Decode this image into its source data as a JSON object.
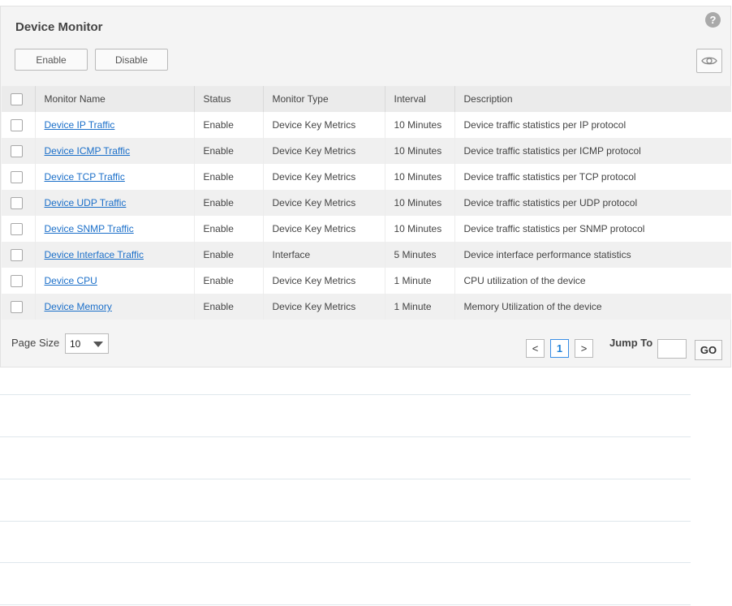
{
  "panel": {
    "title": "Device Monitor",
    "help_glyph": "?",
    "enable_label": "Enable",
    "disable_label": "Disable",
    "eye_icon": "eye-icon"
  },
  "table": {
    "columns": [
      "Monitor Name",
      "Status",
      "Monitor Type",
      "Interval",
      "Description"
    ],
    "rows": [
      {
        "name": "Device IP Traffic",
        "status": "Enable",
        "type": "Device Key Metrics",
        "interval": "10 Minutes",
        "description": "Device traffic statistics per IP protocol"
      },
      {
        "name": "Device ICMP Traffic",
        "status": "Enable",
        "type": "Device Key Metrics",
        "interval": "10 Minutes",
        "description": "Device traffic statistics per ICMP protocol"
      },
      {
        "name": "Device TCP Traffic",
        "status": "Enable",
        "type": "Device Key Metrics",
        "interval": "10 Minutes",
        "description": "Device traffic statistics per TCP protocol"
      },
      {
        "name": "Device UDP Traffic",
        "status": "Enable",
        "type": "Device Key Metrics",
        "interval": "10 Minutes",
        "description": "Device traffic statistics per UDP protocol"
      },
      {
        "name": "Device SNMP Traffic",
        "status": "Enable",
        "type": "Device Key Metrics",
        "interval": "10 Minutes",
        "description": "Device traffic statistics per SNMP protocol"
      },
      {
        "name": "Device Interface Traffic",
        "status": "Enable",
        "type": "Interface",
        "interval": "5 Minutes",
        "description": "Device interface performance statistics"
      },
      {
        "name": "Device CPU",
        "status": "Enable",
        "type": "Device Key Metrics",
        "interval": "1 Minute",
        "description": "CPU utilization of the device"
      },
      {
        "name": "Device Memory",
        "status": "Enable",
        "type": "Device Key Metrics",
        "interval": "1 Minute",
        "description": "Memory Utilization of the device"
      }
    ]
  },
  "pager": {
    "page_size_label": "Page Size",
    "page_size_value": "10",
    "prev_glyph": "<",
    "current_page": "1",
    "next_glyph": ">",
    "jump_label": "Jump To",
    "jump_value": "",
    "go_label": "GO"
  },
  "colors": {
    "link": "#1b6fc9",
    "active_page": "#1e7fd6",
    "panel_bg": "#f4f4f4"
  }
}
